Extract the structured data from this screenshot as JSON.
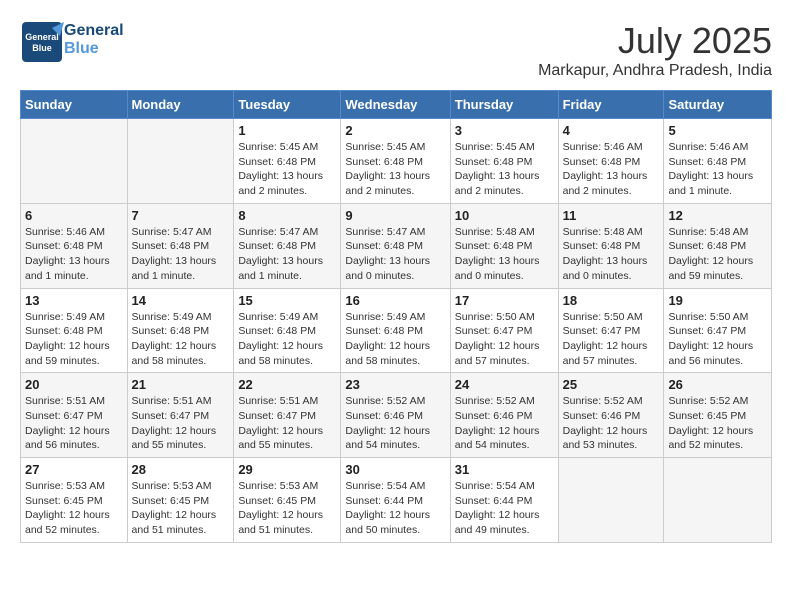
{
  "header": {
    "logo_text1": "General",
    "logo_text2": "Blue",
    "month_year": "July 2025",
    "location": "Markapur, Andhra Pradesh, India"
  },
  "days_of_week": [
    "Sunday",
    "Monday",
    "Tuesday",
    "Wednesday",
    "Thursday",
    "Friday",
    "Saturday"
  ],
  "weeks": [
    [
      {
        "day": "",
        "info": ""
      },
      {
        "day": "",
        "info": ""
      },
      {
        "day": "1",
        "info": "Sunrise: 5:45 AM\nSunset: 6:48 PM\nDaylight: 13 hours and 2 minutes."
      },
      {
        "day": "2",
        "info": "Sunrise: 5:45 AM\nSunset: 6:48 PM\nDaylight: 13 hours and 2 minutes."
      },
      {
        "day": "3",
        "info": "Sunrise: 5:45 AM\nSunset: 6:48 PM\nDaylight: 13 hours and 2 minutes."
      },
      {
        "day": "4",
        "info": "Sunrise: 5:46 AM\nSunset: 6:48 PM\nDaylight: 13 hours and 2 minutes."
      },
      {
        "day": "5",
        "info": "Sunrise: 5:46 AM\nSunset: 6:48 PM\nDaylight: 13 hours and 1 minute."
      }
    ],
    [
      {
        "day": "6",
        "info": "Sunrise: 5:46 AM\nSunset: 6:48 PM\nDaylight: 13 hours and 1 minute."
      },
      {
        "day": "7",
        "info": "Sunrise: 5:47 AM\nSunset: 6:48 PM\nDaylight: 13 hours and 1 minute."
      },
      {
        "day": "8",
        "info": "Sunrise: 5:47 AM\nSunset: 6:48 PM\nDaylight: 13 hours and 1 minute."
      },
      {
        "day": "9",
        "info": "Sunrise: 5:47 AM\nSunset: 6:48 PM\nDaylight: 13 hours and 0 minutes."
      },
      {
        "day": "10",
        "info": "Sunrise: 5:48 AM\nSunset: 6:48 PM\nDaylight: 13 hours and 0 minutes."
      },
      {
        "day": "11",
        "info": "Sunrise: 5:48 AM\nSunset: 6:48 PM\nDaylight: 13 hours and 0 minutes."
      },
      {
        "day": "12",
        "info": "Sunrise: 5:48 AM\nSunset: 6:48 PM\nDaylight: 12 hours and 59 minutes."
      }
    ],
    [
      {
        "day": "13",
        "info": "Sunrise: 5:49 AM\nSunset: 6:48 PM\nDaylight: 12 hours and 59 minutes."
      },
      {
        "day": "14",
        "info": "Sunrise: 5:49 AM\nSunset: 6:48 PM\nDaylight: 12 hours and 58 minutes."
      },
      {
        "day": "15",
        "info": "Sunrise: 5:49 AM\nSunset: 6:48 PM\nDaylight: 12 hours and 58 minutes."
      },
      {
        "day": "16",
        "info": "Sunrise: 5:49 AM\nSunset: 6:48 PM\nDaylight: 12 hours and 58 minutes."
      },
      {
        "day": "17",
        "info": "Sunrise: 5:50 AM\nSunset: 6:47 PM\nDaylight: 12 hours and 57 minutes."
      },
      {
        "day": "18",
        "info": "Sunrise: 5:50 AM\nSunset: 6:47 PM\nDaylight: 12 hours and 57 minutes."
      },
      {
        "day": "19",
        "info": "Sunrise: 5:50 AM\nSunset: 6:47 PM\nDaylight: 12 hours and 56 minutes."
      }
    ],
    [
      {
        "day": "20",
        "info": "Sunrise: 5:51 AM\nSunset: 6:47 PM\nDaylight: 12 hours and 56 minutes."
      },
      {
        "day": "21",
        "info": "Sunrise: 5:51 AM\nSunset: 6:47 PM\nDaylight: 12 hours and 55 minutes."
      },
      {
        "day": "22",
        "info": "Sunrise: 5:51 AM\nSunset: 6:47 PM\nDaylight: 12 hours and 55 minutes."
      },
      {
        "day": "23",
        "info": "Sunrise: 5:52 AM\nSunset: 6:46 PM\nDaylight: 12 hours and 54 minutes."
      },
      {
        "day": "24",
        "info": "Sunrise: 5:52 AM\nSunset: 6:46 PM\nDaylight: 12 hours and 54 minutes."
      },
      {
        "day": "25",
        "info": "Sunrise: 5:52 AM\nSunset: 6:46 PM\nDaylight: 12 hours and 53 minutes."
      },
      {
        "day": "26",
        "info": "Sunrise: 5:52 AM\nSunset: 6:45 PM\nDaylight: 12 hours and 52 minutes."
      }
    ],
    [
      {
        "day": "27",
        "info": "Sunrise: 5:53 AM\nSunset: 6:45 PM\nDaylight: 12 hours and 52 minutes."
      },
      {
        "day": "28",
        "info": "Sunrise: 5:53 AM\nSunset: 6:45 PM\nDaylight: 12 hours and 51 minutes."
      },
      {
        "day": "29",
        "info": "Sunrise: 5:53 AM\nSunset: 6:45 PM\nDaylight: 12 hours and 51 minutes."
      },
      {
        "day": "30",
        "info": "Sunrise: 5:54 AM\nSunset: 6:44 PM\nDaylight: 12 hours and 50 minutes."
      },
      {
        "day": "31",
        "info": "Sunrise: 5:54 AM\nSunset: 6:44 PM\nDaylight: 12 hours and 49 minutes."
      },
      {
        "day": "",
        "info": ""
      },
      {
        "day": "",
        "info": ""
      }
    ]
  ]
}
